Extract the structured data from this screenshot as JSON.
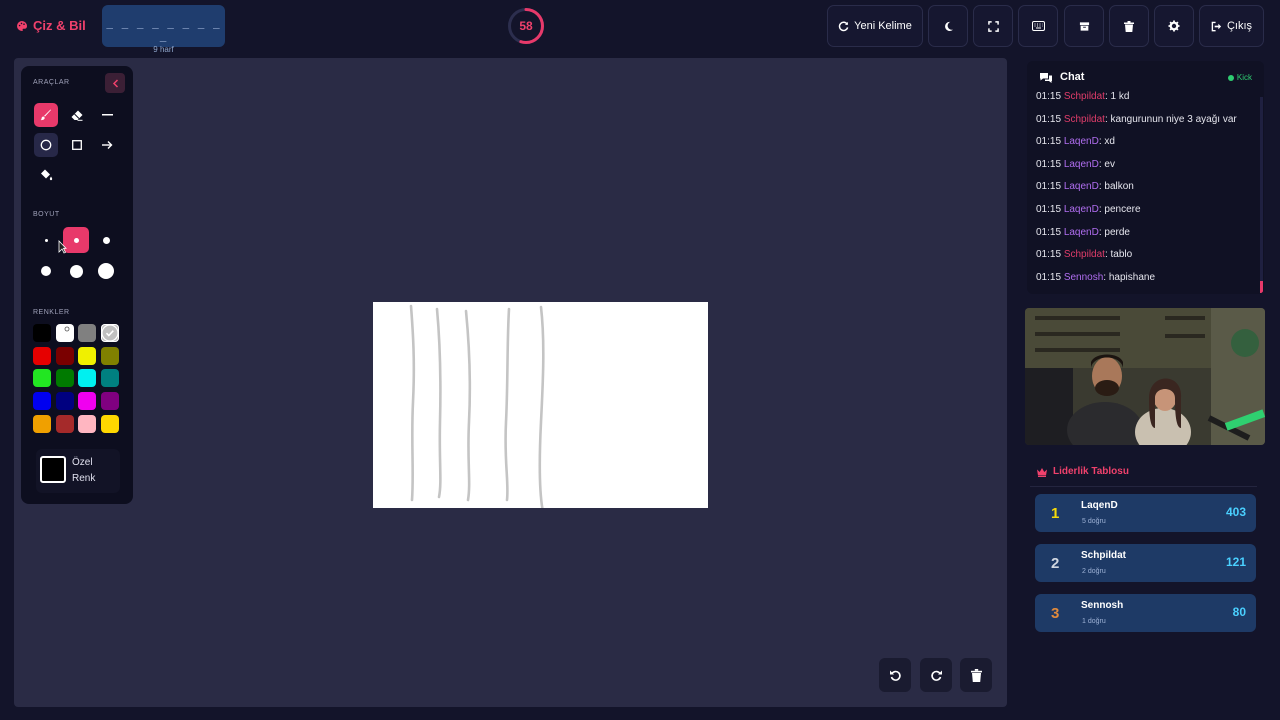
{
  "app": {
    "title": "Çiz & Bil"
  },
  "word": {
    "mask": "_ _ _ _ _ _ _ _ _",
    "length_label": "9 harf"
  },
  "timer": {
    "seconds": "58",
    "progress": 0.55
  },
  "toolbar": {
    "new_word_label": "Yeni Kelime",
    "exit_label": "Çıkış",
    "icons": [
      "moon-icon",
      "fullscreen-icon",
      "keyboard-icon",
      "archive-icon",
      "trash-icon",
      "gear-icon"
    ]
  },
  "tools": {
    "section_tools": "ARAÇLAR",
    "section_size": "BOYUT",
    "section_colors": "RENKLER",
    "custom_color_label": "Özel Renk",
    "active_tool": "brush",
    "active_size": 2,
    "colors": [
      "#000000",
      "#ffffff",
      "#808080",
      "#c0c0c0",
      "#e60000",
      "#7a0000",
      "#f0f000",
      "#808000",
      "#22e622",
      "#007a00",
      "#00f0f0",
      "#008080",
      "#0000f0",
      "#000080",
      "#f000f0",
      "#800080",
      "#f0a000",
      "#a52a2a",
      "#ffb6c1",
      "#ffd700"
    ],
    "selected_color": "#c0c0c0"
  },
  "chat": {
    "title": "Chat",
    "platform": "Kick",
    "messages": [
      {
        "time": "01:15",
        "user": "Schpildat",
        "user_color": "red",
        "text": ": 1 kd"
      },
      {
        "time": "01:15",
        "user": "Schpildat",
        "user_color": "red",
        "text": ": kangurunun niye 3 ayağı var"
      },
      {
        "time": "01:15",
        "user": "LaqenD",
        "user_color": "purple",
        "text": ": xd"
      },
      {
        "time": "01:15",
        "user": "LaqenD",
        "user_color": "purple",
        "text": ": ev"
      },
      {
        "time": "01:15",
        "user": "LaqenD",
        "user_color": "purple",
        "text": ": balkon"
      },
      {
        "time": "01:15",
        "user": "LaqenD",
        "user_color": "purple",
        "text": ": pencere"
      },
      {
        "time": "01:15",
        "user": "LaqenD",
        "user_color": "purple",
        "text": ": perde"
      },
      {
        "time": "01:15",
        "user": "Schpildat",
        "user_color": "red",
        "text": ": tablo"
      },
      {
        "time": "01:15",
        "user": "Sennosh",
        "user_color": "purple",
        "text": ": hapishane"
      }
    ]
  },
  "leaderboard": {
    "title": "Liderlik Tablosu",
    "rows": [
      {
        "rank": "1",
        "name": "LaqenD",
        "sub": "5 doğru",
        "score": "403",
        "rank_color": "#f5d90a"
      },
      {
        "rank": "2",
        "name": "Schpildat",
        "sub": "2 doğru",
        "score": "121",
        "rank_color": "#d0d6e0"
      },
      {
        "rank": "3",
        "name": "Sennosh",
        "sub": "1 doğru",
        "score": "80",
        "rank_color": "#e08a3c"
      }
    ]
  }
}
